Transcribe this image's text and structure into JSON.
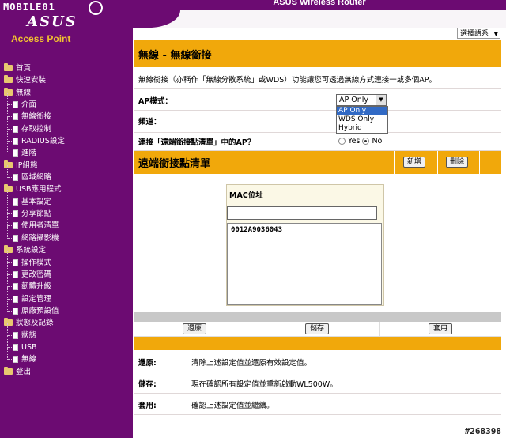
{
  "logo": {
    "top_text": "MOBILE01",
    "brand": "ASUS",
    "product": "Access Point"
  },
  "banner": {
    "title": "ASUS Wireless Router"
  },
  "language": {
    "selected": "選擇語系"
  },
  "menu": [
    {
      "type": "top",
      "label": "首頁"
    },
    {
      "type": "top",
      "label": "快速安裝"
    },
    {
      "type": "top",
      "label": "無線"
    },
    {
      "type": "sub",
      "label": "介面"
    },
    {
      "type": "sub",
      "label": "無線銜接"
    },
    {
      "type": "sub",
      "label": "存取控制"
    },
    {
      "type": "sub",
      "label": "RADIUS設定"
    },
    {
      "type": "sub",
      "label": "進階"
    },
    {
      "type": "top",
      "label": "IP組態"
    },
    {
      "type": "sub",
      "label": "區域網路"
    },
    {
      "type": "top",
      "label": "USB應用程式"
    },
    {
      "type": "sub",
      "label": "基本設定"
    },
    {
      "type": "sub",
      "label": "分享節點"
    },
    {
      "type": "sub",
      "label": "使用者清單"
    },
    {
      "type": "sub",
      "label": "網路攝影機"
    },
    {
      "type": "top",
      "label": "系統設定"
    },
    {
      "type": "sub",
      "label": "操作模式"
    },
    {
      "type": "sub",
      "label": "更改密碼"
    },
    {
      "type": "sub",
      "label": "韌體升級"
    },
    {
      "type": "sub",
      "label": "設定管理"
    },
    {
      "type": "sub",
      "label": "原廠預設值"
    },
    {
      "type": "top",
      "label": "狀態及記錄"
    },
    {
      "type": "sub",
      "label": "狀態"
    },
    {
      "type": "sub",
      "label": "USB"
    },
    {
      "type": "sub",
      "label": "無線"
    },
    {
      "type": "top",
      "label": "登出"
    }
  ],
  "page": {
    "title": "無線 - 無線銜接",
    "description": "無線銜接（亦稱作「無線分散系統」或WDS）功能讓您可透過無線方式連接一或多個AP。",
    "ap_mode_label": "AP模式：",
    "ap_mode_value": "AP Only",
    "ap_mode_options": [
      "AP Only",
      "WDS Only",
      "Hybrid"
    ],
    "channel_label": "頻道：",
    "connect_label": "連接「遠端銜接點清單」中的AP？",
    "yes_label": "Yes",
    "no_label": "No"
  },
  "remote_list": {
    "title": "遠端銜接點清單",
    "add_button": "新增",
    "delete_button": "刪除",
    "mac_header": "MAC位址",
    "mac_input_value": "",
    "entries": [
      "0012A9036043"
    ]
  },
  "actions": {
    "restore": "還原",
    "save": "儲存",
    "apply": "套用"
  },
  "help": [
    {
      "key": "還原:",
      "value": "清除上述設定值並還原有效設定值。"
    },
    {
      "key": "儲存:",
      "value": "現在確認所有設定值並重新啟動WL500W。"
    },
    {
      "key": "套用:",
      "value": "確認上述設定值並繼續。"
    }
  ],
  "watermark": "#268398"
}
